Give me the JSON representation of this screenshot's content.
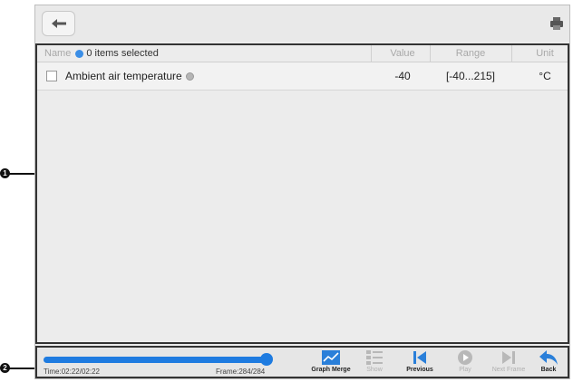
{
  "callouts": [
    "1",
    "2"
  ],
  "toolbar_top": {
    "back_icon": "back-arrow-icon",
    "print_icon": "printer-icon"
  },
  "table": {
    "header": {
      "name": "Name",
      "selected_text": "0 items selected",
      "value": "Value",
      "range": "Range",
      "unit": "Unit"
    },
    "rows": [
      {
        "name": "Ambient air temperature",
        "value": "-40",
        "range": "[-40...215]",
        "unit": "°C"
      }
    ]
  },
  "playback": {
    "progress_fraction": 1.0,
    "time": "Time:02:22/02:22",
    "frame": "Frame:284/284"
  },
  "buttons": {
    "graph_merge": "Graph Merge",
    "show": "Show",
    "previous": "Previous",
    "play": "Play",
    "next_frame": "Next Frame",
    "back": "Back"
  },
  "colors": {
    "accent": "#1e7be0",
    "disabled": "#b0b0b0"
  }
}
